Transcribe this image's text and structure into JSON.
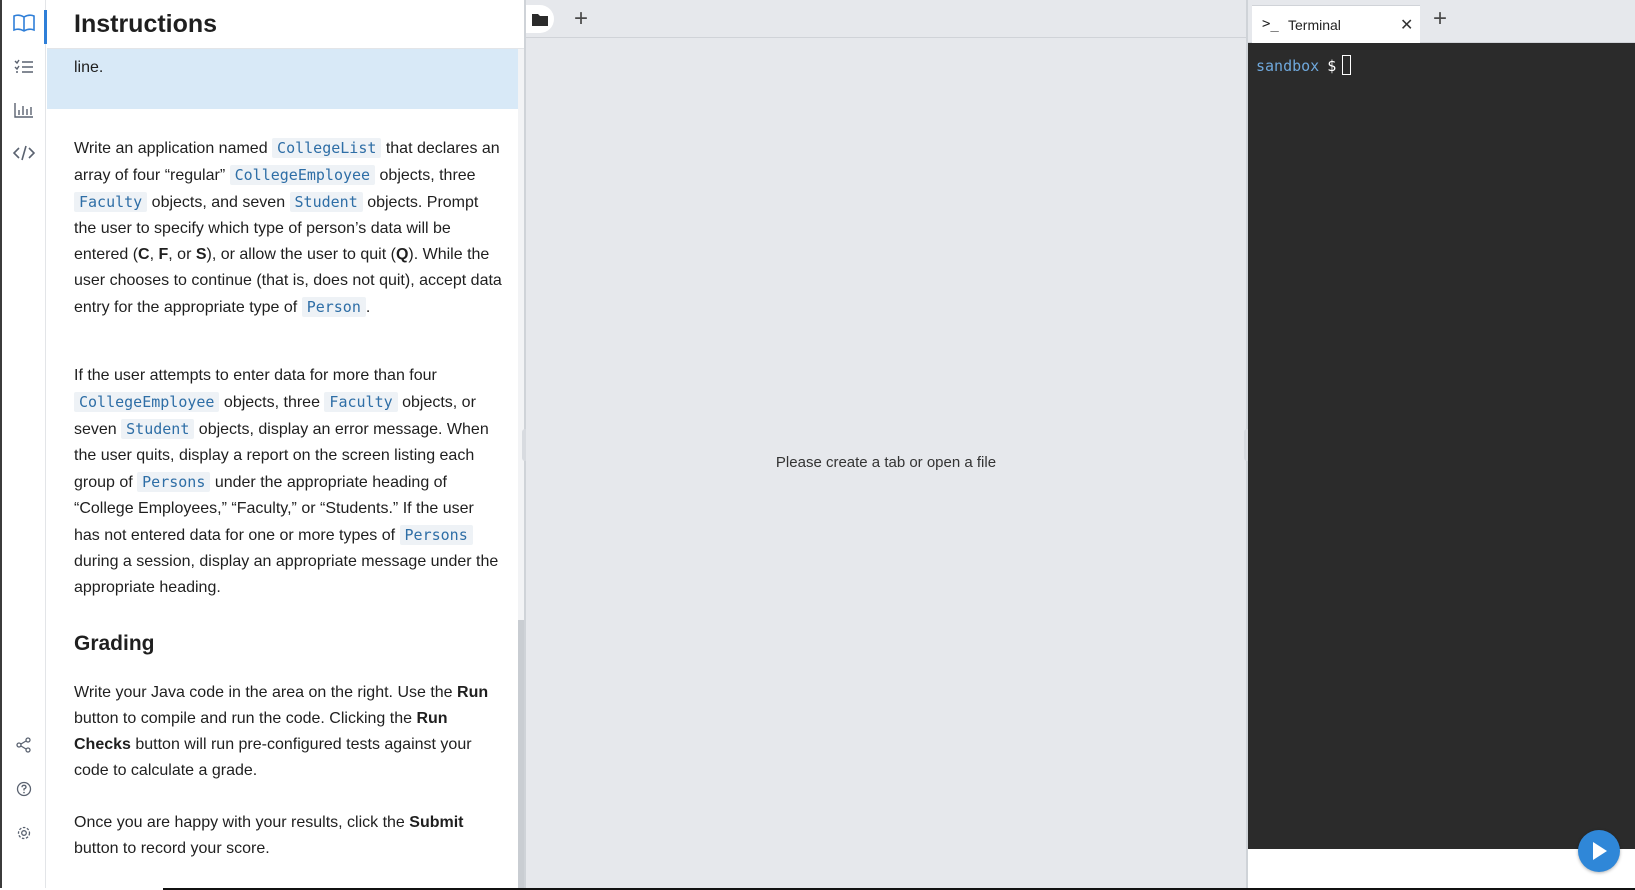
{
  "rail": {
    "items": [
      {
        "name": "book-icon"
      },
      {
        "name": "checklist-icon"
      },
      {
        "name": "bar-chart-icon"
      },
      {
        "name": "code-icon"
      },
      {
        "name": "share-icon"
      },
      {
        "name": "help-icon"
      },
      {
        "name": "settings-icon"
      }
    ],
    "accent": "#2f7fd8"
  },
  "instructions": {
    "title": "Instructions",
    "highlight_tail": "line.",
    "p1": {
      "t1": "Write an application named ",
      "c1": "CollegeList",
      "t2": " that declares an array of four “regular” ",
      "c2": "CollegeEmployee",
      "t3": " objects, three ",
      "c3": "Faculty",
      "t4": " objects, and seven ",
      "c4": "Student",
      "t5": " objects. Prompt the user to specify which type of person’s data will be entered (",
      "b1": "C",
      "t6": ", ",
      "b2": "F",
      "t7": ", or ",
      "b3": "S",
      "t8": "), or allow the user to quit (",
      "b4": "Q",
      "t9": "). While the user chooses to continue (that is, does not quit), accept data entry for the appropriate type of ",
      "c5": "Person",
      "t10": "."
    },
    "p2": {
      "t1": "If the user attempts to enter data for more than four ",
      "c1": "CollegeEmployee",
      "t2": " objects, three ",
      "c2": "Faculty",
      "t3": " objects, or seven ",
      "c3": "Student",
      "t4": " objects, display an error message. When the user quits, display a report on the screen listing each group of ",
      "c4": "Persons",
      "t5": " under the appropriate heading of “College Employees,” “Faculty,” or “Students.” If the user has not entered data for one or more types of ",
      "c5": "Persons",
      "t6": " during a session, display an appropriate message under the appropriate heading."
    },
    "grading_heading": "Grading",
    "p3": {
      "t1": "Write your Java code in the area on the right. Use the ",
      "b1": "Run",
      "t2": " button to compile and run the code. Clicking the ",
      "b2": "Run Checks",
      "t3": " button will run pre-configured tests against your code to calculate a grade."
    },
    "p4": {
      "t1": "Once you are happy with your results, click the ",
      "b1": "Submit",
      "t2": " button to record your score."
    }
  },
  "editor": {
    "empty_message": "Please create a tab or open a file"
  },
  "terminal": {
    "tab_icon": ">_",
    "tab_label": "Terminal",
    "prompt_host": "sandbox",
    "prompt_sign": "$"
  }
}
